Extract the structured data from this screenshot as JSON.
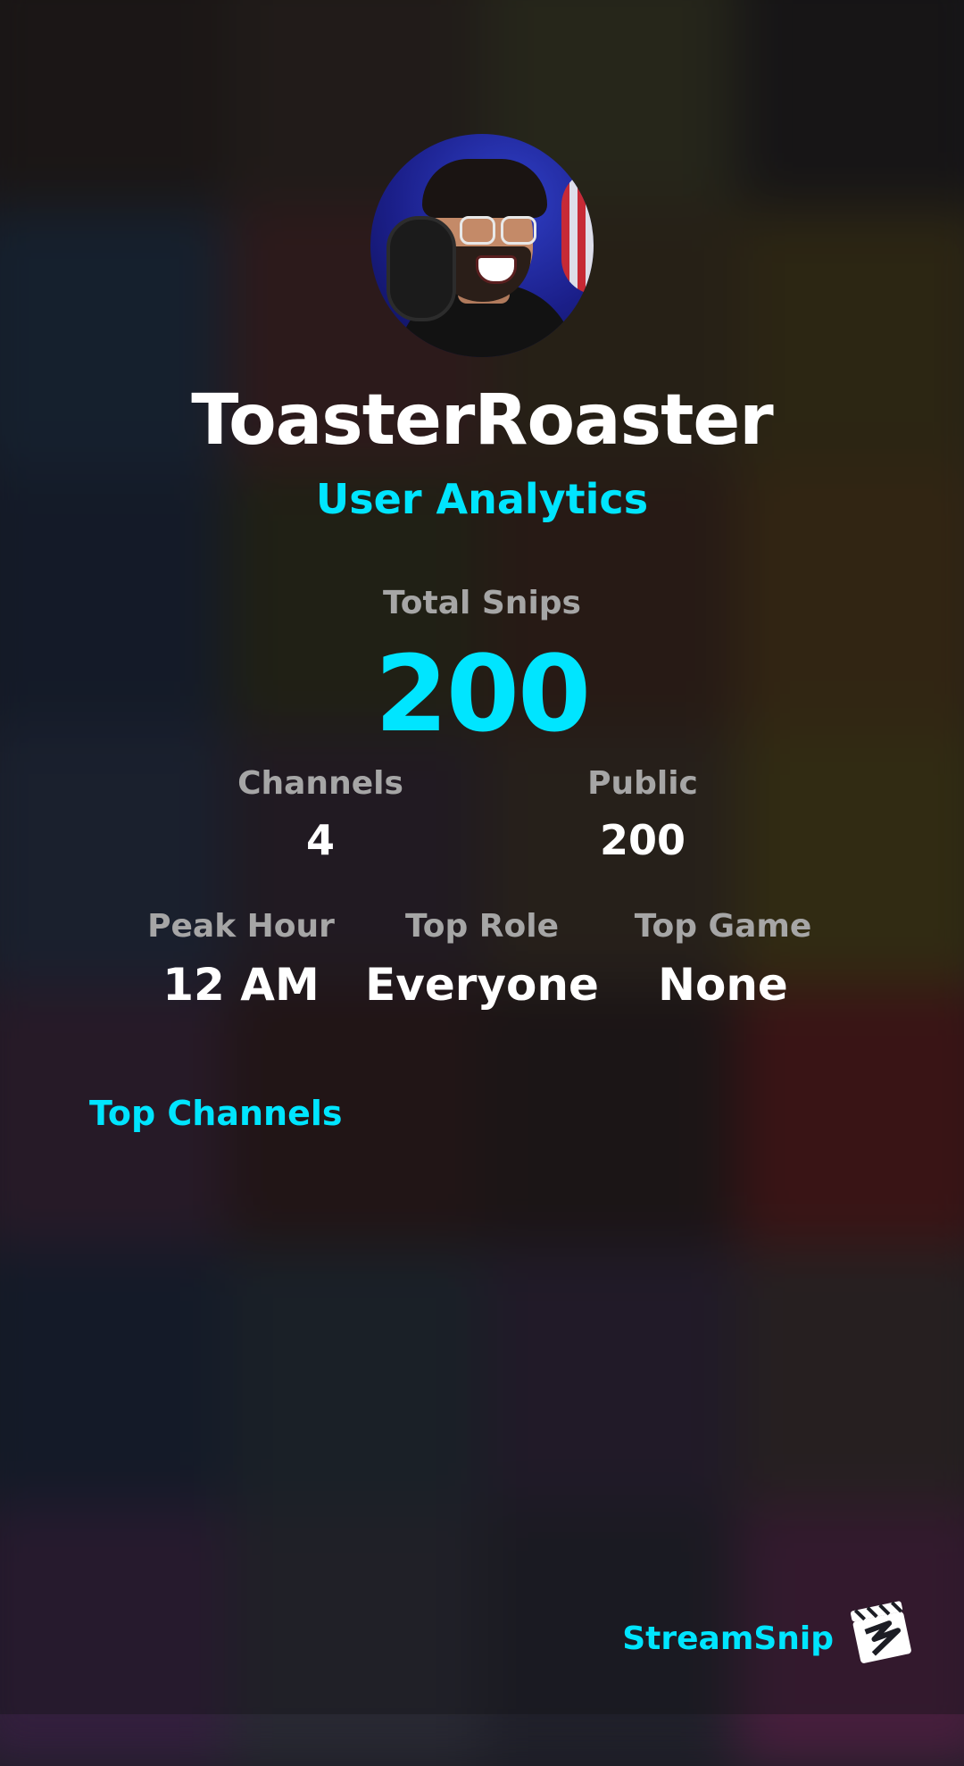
{
  "profile": {
    "username": "ToasterRoaster",
    "subtitle": "User Analytics"
  },
  "stats": {
    "total_snips": {
      "label": "Total Snips",
      "value": "200"
    },
    "channels": {
      "label": "Channels",
      "value": "4"
    },
    "public": {
      "label": "Public",
      "value": "200"
    },
    "peak_hour": {
      "label": "Peak Hour",
      "value": "12 AM"
    },
    "top_role": {
      "label": "Top Role",
      "value": "Everyone"
    },
    "top_game": {
      "label": "Top Game",
      "value": "None"
    }
  },
  "sections": {
    "top_channels_title": "Top Channels"
  },
  "brand": {
    "name": "StreamSnip",
    "logo_icon": "clapperboard-logo-icon"
  },
  "colors": {
    "accent": "#00e5ff",
    "primary_text": "#ffffff",
    "muted_text": "#a6a6a6"
  }
}
